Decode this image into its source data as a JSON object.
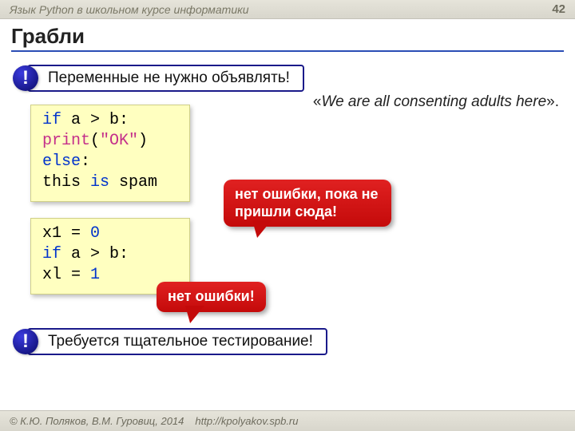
{
  "header": {
    "course": "Язык Python в школьном курсе информатики",
    "page": "42"
  },
  "title": "Грабли",
  "callout1": {
    "mark": "!",
    "text": "Переменные не нужно объявлять!"
  },
  "quote": {
    "open": "«",
    "body": "We are all consenting adults here",
    "close": "»."
  },
  "code1": {
    "l1a": "if",
    "l1b": " a > b:",
    "l2a": "  ",
    "l2b": "print",
    "l2c": "(",
    "l2d": "\"OK\"",
    "l2e": ")",
    "l3a": "else",
    "l3b": ":",
    "l4a": "  this ",
    "l4b": "is",
    "l4c": " spam"
  },
  "code2": {
    "l1a": "x1 = ",
    "l1b": "0",
    "l2a": "if",
    "l2b": " a > b:",
    "l3a": "  xl = ",
    "l3b": "1"
  },
  "bubble1": "нет ошибки, пока не пришли сюда!",
  "bubble2": "нет ошибки!",
  "callout2": {
    "mark": "!",
    "text": "Требуется тщательное тестирование!"
  },
  "footer": {
    "copyright": "© К.Ю. Поляков, В.М. Гуровиц, 2014",
    "url": "http://kpolyakov.spb.ru"
  }
}
